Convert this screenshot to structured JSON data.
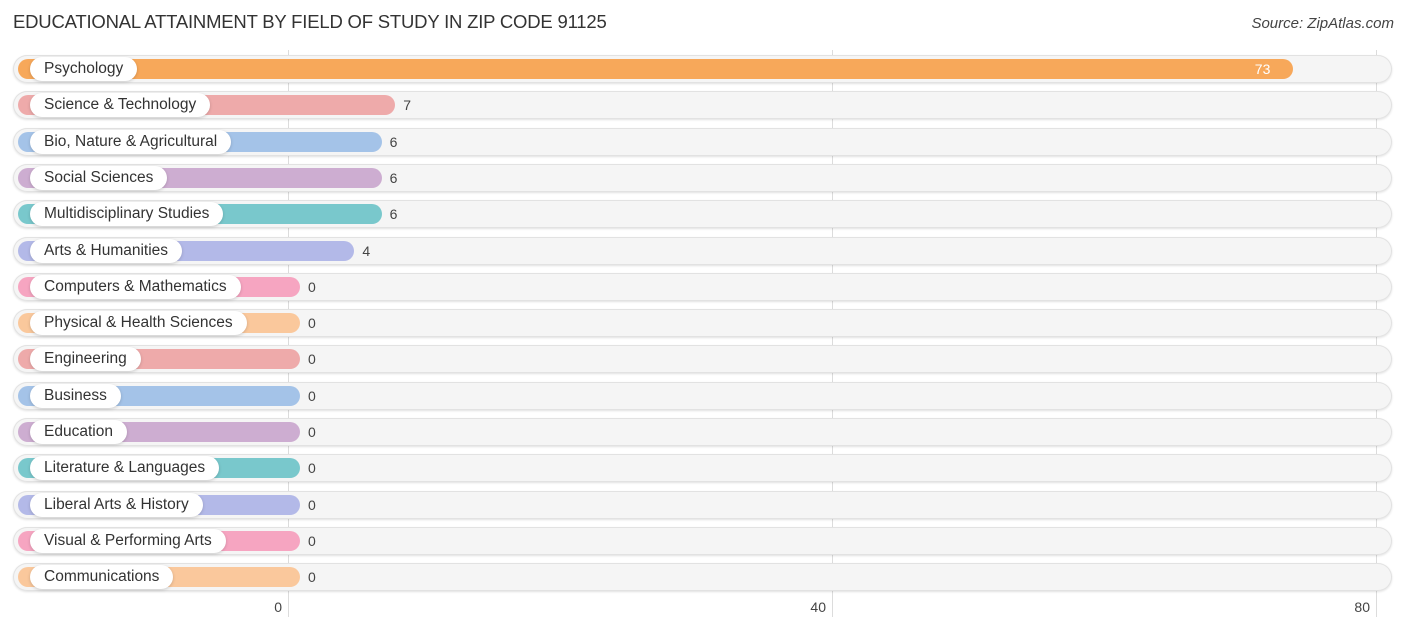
{
  "header": {
    "title": "EDUCATIONAL ATTAINMENT BY FIELD OF STUDY IN ZIP CODE 91125",
    "source": "Source: ZipAtlas.com"
  },
  "chart_data": {
    "type": "bar",
    "orientation": "horizontal",
    "title": "EDUCATIONAL ATTAINMENT BY FIELD OF STUDY IN ZIP CODE 91125",
    "xlabel": "",
    "ylabel": "",
    "xlim": [
      0,
      80
    ],
    "x_ticks": [
      "0",
      "40",
      "80"
    ],
    "grid": true,
    "categories": [
      "Psychology",
      "Science & Technology",
      "Bio, Nature & Agricultural",
      "Social Sciences",
      "Multidisciplinary Studies",
      "Arts & Humanities",
      "Computers & Mathematics",
      "Physical & Health Sciences",
      "Engineering",
      "Business",
      "Education",
      "Literature & Languages",
      "Liberal Arts & History",
      "Visual & Performing Arts",
      "Communications"
    ],
    "values": [
      73,
      7,
      6,
      6,
      6,
      4,
      0,
      0,
      0,
      0,
      0,
      0,
      0,
      0,
      0
    ],
    "value_labels": [
      "73",
      "7",
      "6",
      "6",
      "6",
      "4",
      "0",
      "0",
      "0",
      "0",
      "0",
      "0",
      "0",
      "0",
      "0"
    ],
    "colors": [
      "#f7a85a",
      "#eeaaaa",
      "#a4c3e8",
      "#cdadd1",
      "#79c8cc",
      "#b3b9e8",
      "#f6a5c1",
      "#fac89c",
      "#eeaaaa",
      "#a4c3e8",
      "#cdadd1",
      "#79c8cc",
      "#b3b9e8",
      "#f6a5c1",
      "#fac89c"
    ]
  }
}
